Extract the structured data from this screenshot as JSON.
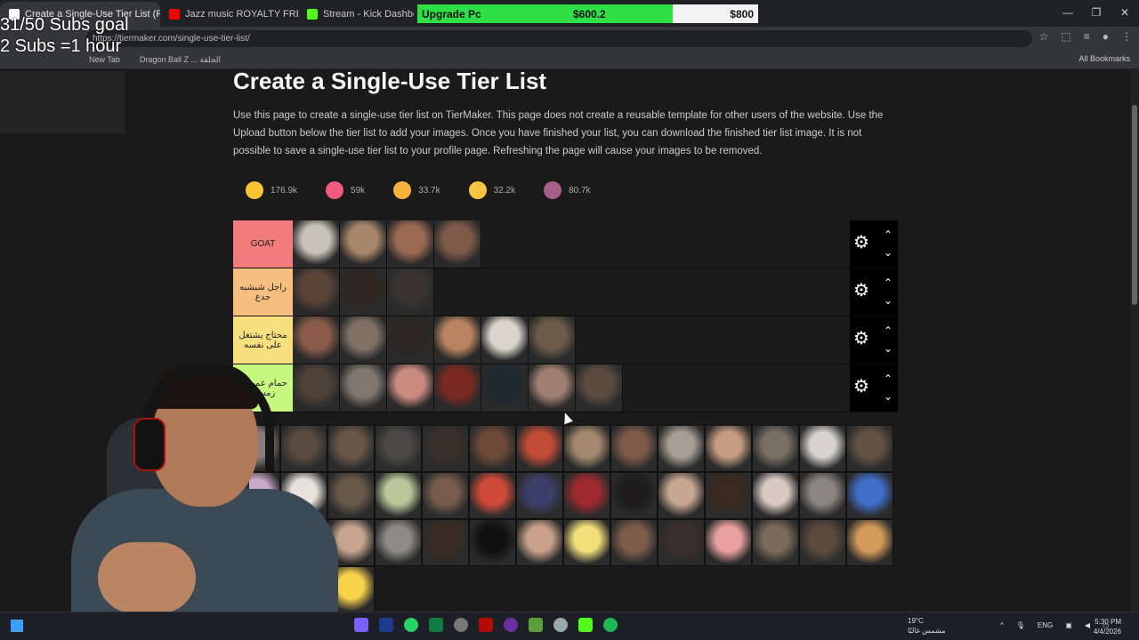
{
  "tabs": [
    {
      "label": "Create a Single-Use Tier List (R",
      "active": true,
      "color": "#ffffff"
    },
    {
      "label": "Jazz music ROYALTY FREE Backs",
      "active": false,
      "color": "#ff0000"
    },
    {
      "label": "Stream - Kick Dashboard",
      "active": false,
      "color": "#53fc18"
    }
  ],
  "overlay": {
    "name": "Upgrade Pc",
    "current": "$600.2",
    "target": "$800",
    "progress": 0.75
  },
  "goal": {
    "line1": "31/50 Subs goal",
    "line2": "2 Subs =1 hour"
  },
  "address": {
    "url": "https://tiermaker.com/single-use-tier-list/"
  },
  "bookmarks": {
    "items": [
      "New Tab",
      "Dragon Ball Z ... الحلقة"
    ],
    "all": "All Bookmarks"
  },
  "page": {
    "title": "Create a Single-Use Tier List",
    "intro": "Use this page to create a single-use tier list on TierMaker. This page does not create a reusable template for other users of the website. Use the Upload button below the tier list to add your images. Once you have finished your list, you can download the finished tier list image. It is not possible to save a single-use tier list to your profile page. Refreshing the page will cause your images to be removed."
  },
  "reactions": [
    {
      "icon": "grin-emoji-icon",
      "count": "176.9k",
      "color": "#f7c532"
    },
    {
      "icon": "heart-eyes-emoji-icon",
      "count": "59k",
      "color": "#f05a7e"
    },
    {
      "icon": "laugh-emoji-icon",
      "count": "33.7k",
      "color": "#f7b23b"
    },
    {
      "icon": "clap-emoji-icon",
      "count": "32.2k",
      "color": "#f5c542"
    },
    {
      "icon": "poop-emoji-icon",
      "count": "80.7k",
      "color": "#a45f8a"
    }
  ],
  "tiers": [
    {
      "label": "GOAT",
      "color": "#f27c7c",
      "items": [
        "#c9c2b8",
        "#a8866b",
        "#9b6a52",
        "#7d5a48"
      ]
    },
    {
      "label": "راجل شبشبه جدع",
      "color": "#f7bf7f",
      "items": [
        "#5b4336",
        "#2f2622",
        "#3a3431"
      ]
    },
    {
      "label": "محتاج يشتغل على نفسه",
      "color": "#f7de7f",
      "items": [
        "#8a5b4a",
        "#807066",
        "#2c2724",
        "#b9845f",
        "#d9d4cc",
        "#6e5a49"
      ]
    },
    {
      "label": "حمام عمومي زمستر",
      "color": "#c6f77f",
      "items": [
        "#4d4138",
        "#7f7770",
        "#c98a80",
        "#7a2a22",
        "#1f2930",
        "#9f8070",
        "#5b4a40"
      ]
    }
  ],
  "pool": [
    "#8a7f78",
    "#5a4a3e",
    "#6b5747",
    "#4b4a48",
    "#3b2f2a",
    "#6f4a38",
    "#c04b37",
    "#a5896f",
    "#7e5a48",
    "#a79f95",
    "#c79d82",
    "#7a6f65",
    "#d7d2cc",
    "#645244",
    "#c9a9c9",
    "#e9e2dc",
    "#6a5a4a",
    "#b7c79a",
    "#775c4d",
    "#d04a3a",
    "#3c3f6a",
    "#9d2a2e",
    "#1e1c1c",
    "#c7a692",
    "#3a2a20",
    "#d8cac2",
    "#8b8580",
    "#3f6fc8",
    "#f5a0a0",
    "#c97a6a",
    "#c6a48f",
    "#8e8a86",
    "#3a2c24",
    "#101010",
    "#c9a18a",
    "#f2e07a",
    "#7d5c4a",
    "#3a2f2a",
    "#e8a0a0",
    "#7a6a5a",
    "#5c4a3e",
    "#d49a5a",
    "#c9c3bb",
    "#b7b9b5",
    "#f7d34a"
  ],
  "tier_controls": {
    "settings_icon": "gear-icon",
    "up_icon": "chevron-up-icon",
    "down_icon": "chevron-down-icon"
  },
  "weather": {
    "temp": "19°C",
    "desc": "مشمس غالبًا"
  },
  "tray": {
    "lang": "ENG"
  },
  "clock": {
    "time": "5:30 PM",
    "date": "4/4/2026"
  }
}
